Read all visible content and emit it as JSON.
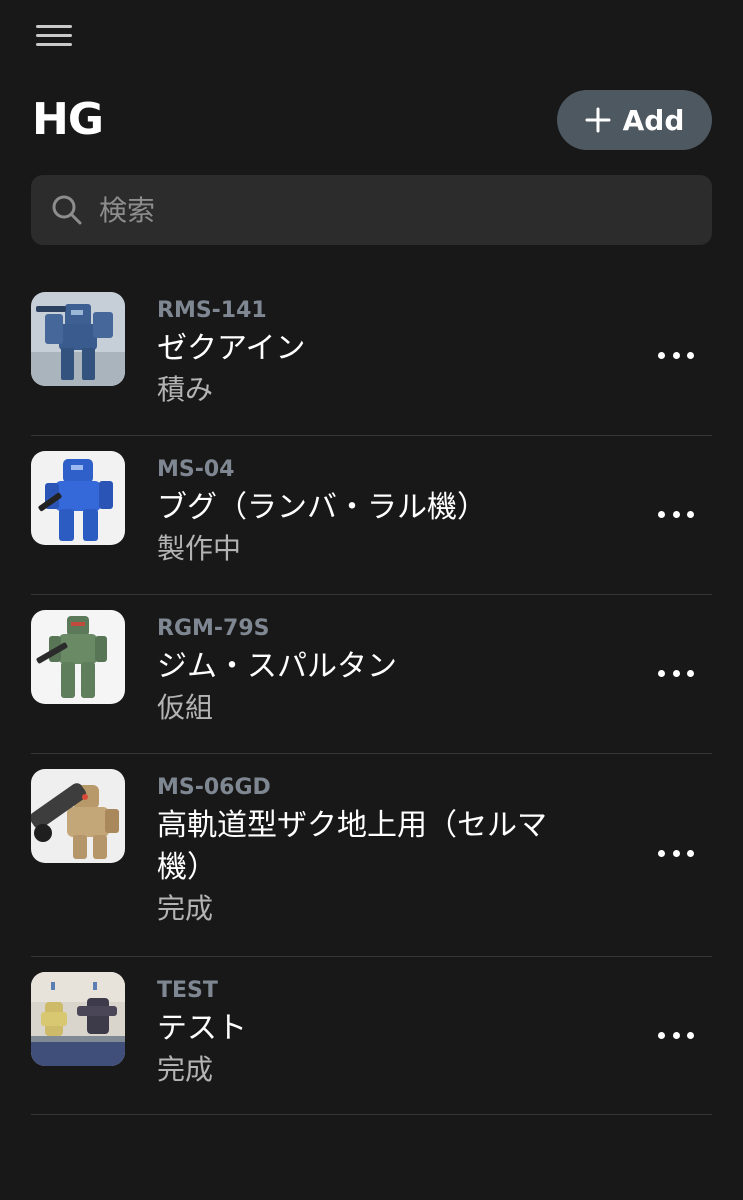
{
  "header": {
    "title": "HG",
    "add_label": "Add"
  },
  "search": {
    "placeholder": "検索"
  },
  "kits": [
    {
      "code": "RMS-141",
      "name": "ゼクアイン",
      "status": "積み",
      "image": "blue-mobile-suit-photo"
    },
    {
      "code": "MS-04",
      "name": "ブグ（ランバ・ラル機）",
      "status": "製作中",
      "image": "blue-mobile-suit-with-rifle-photo"
    },
    {
      "code": "RGM-79S",
      "name": "ジム・スパルタン",
      "status": "仮組",
      "image": "green-mobile-suit-photo"
    },
    {
      "code": "MS-06GD",
      "name": "高軌道型ザク地上用（セルマ機）",
      "status": "完成",
      "image": "tan-mobile-suit-with-bazooka-photo"
    },
    {
      "code": "TEST",
      "name": "テスト",
      "status": "完成",
      "image": "diorama-photo"
    }
  ]
}
